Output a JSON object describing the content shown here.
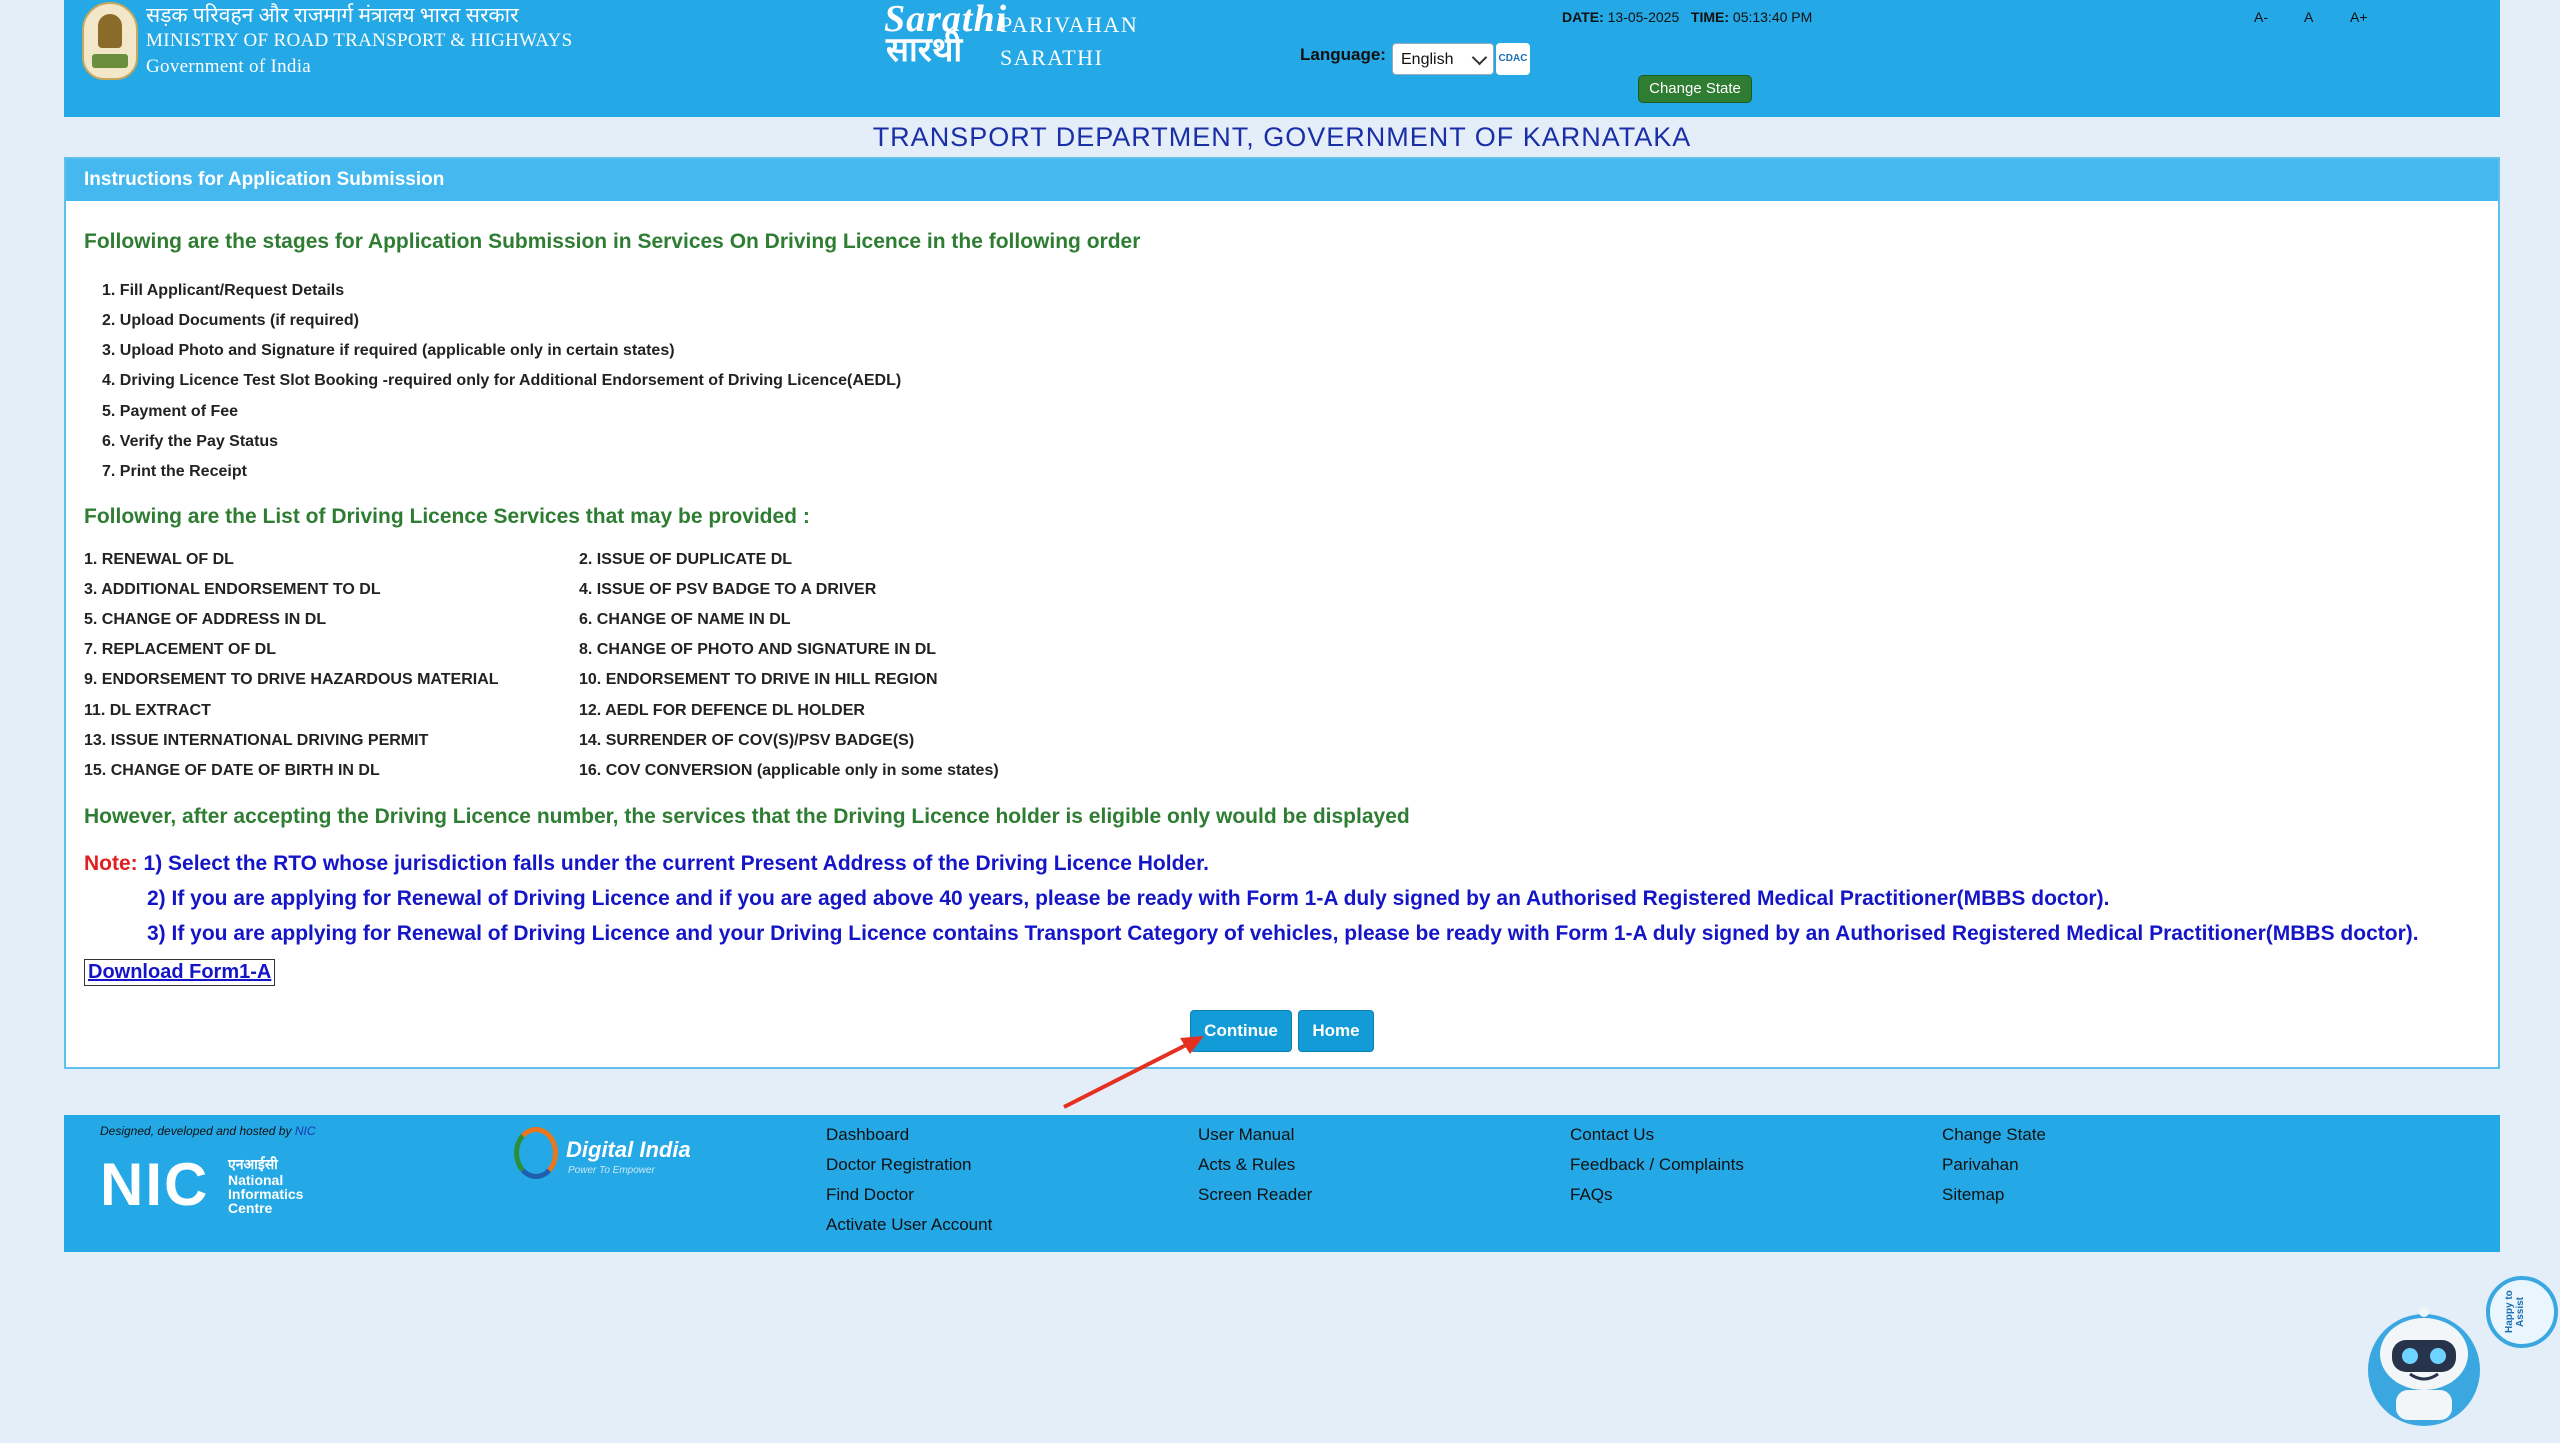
{
  "header": {
    "ministry_hindi": "सड़क परिवहन और राजमार्ग मंत्रालय भारत सरकार",
    "ministry_english": "MINISTRY OF ROAD TRANSPORT & HIGHWAYS",
    "government": "Government of India",
    "sarathi_script": "Sarathi",
    "sarathi_script_hindi": "सारथी",
    "parivahan": "PARIVAHAN",
    "sarathi": "SARATHI",
    "language_label": "Language:",
    "language_value": "English",
    "cdac_label": "सी-डैक CDAC",
    "date_label": "DATE:",
    "date_value": "13-05-2025",
    "time_label": "TIME:",
    "time_value": "05:13:40 PM",
    "change_state": "Change State",
    "font_decrease": "A-",
    "font_normal": "A",
    "font_increase": "A+"
  },
  "dept_title": "TRANSPORT DEPARTMENT, GOVERNMENT OF KARNATAKA",
  "panel": {
    "heading": "Instructions for Application Submission",
    "stages_heading": "Following are the stages for Application Submission in Services On Driving Licence in the following order",
    "stages": [
      "1. Fill Applicant/Request Details",
      "2. Upload Documents (if required)",
      "3. Upload Photo and Signature if required (applicable only in certain states)",
      "4. Driving Licence Test Slot Booking -required only for Additional Endorsement of Driving Licence(AEDL)",
      "5. Payment of Fee",
      "6. Verify the Pay Status",
      "7. Print the Receipt"
    ],
    "services_heading": "Following are the List of Driving Licence Services that may be provided :",
    "services_left": [
      "1.  RENEWAL OF DL",
      "3.  ADDITIONAL ENDORSEMENT TO DL",
      "5.  CHANGE OF ADDRESS IN DL",
      "7.  REPLACEMENT OF DL",
      "9.  ENDORSEMENT TO DRIVE HAZARDOUS MATERIAL",
      "11. DL EXTRACT",
      "13. ISSUE INTERNATIONAL DRIVING PERMIT",
      "15. CHANGE OF DATE OF BIRTH IN DL"
    ],
    "services_right": [
      "2.  ISSUE OF DUPLICATE DL",
      "4.  ISSUE OF PSV BADGE TO A DRIVER",
      "6.  CHANGE OF NAME IN DL",
      "8.  CHANGE OF PHOTO AND SIGNATURE IN DL",
      "10. ENDORSEMENT TO DRIVE IN HILL REGION",
      "12. AEDL FOR DEFENCE DL HOLDER",
      "14. SURRENDER OF COV(S)/PSV BADGE(S)",
      "16. COV CONVERSION (applicable only in some states)"
    ],
    "however_text": "However, after accepting the Driving Licence number, the services that the Driving Licence holder is eligible only would be displayed",
    "note_label": "Note:",
    "notes": [
      "1) Select the RTO whose jurisdiction falls under the current Present Address of the Driving Licence Holder.",
      "2) If you are applying for Renewal of Driving Licence and if you are aged above 40 years, please be ready with Form 1-A duly signed by an Authorised Registered Medical Practitioner(MBBS doctor).",
      "3) If you are applying for Renewal of Driving Licence and your Driving Licence contains Transport Category of vehicles, please be ready with Form 1-A duly signed by an Authorised Registered Medical Practitioner(MBBS doctor)."
    ],
    "download_link": "Download Form1-A",
    "continue_button": "Continue",
    "home_button": "Home"
  },
  "footer": {
    "designed_text": "Designed, developed and hosted by",
    "designed_by": "NIC",
    "nic_logo": "NIC",
    "nic_hindi": "एनआईसी",
    "nic_full": "National Informatics Centre",
    "digital_india": "Digital India",
    "digital_india_tag": "Power To Empower",
    "col1": [
      "Dashboard",
      "Doctor Registration",
      "Find Doctor",
      "Activate User Account"
    ],
    "col2": [
      "User Manual",
      "Acts & Rules",
      "Screen Reader"
    ],
    "col3": [
      "Contact Us",
      "Feedback / Complaints",
      "FAQs"
    ],
    "col4": [
      "Change State",
      "Parivahan",
      "Sitemap"
    ]
  },
  "chatbot": {
    "bubble_text": "Happy to Assist"
  },
  "colors": {
    "header_blue": "#24a8e6",
    "panel_head": "#45b9ef",
    "heading_green": "#2e7d32",
    "note_blue": "#1515c8",
    "note_red": "#e02020",
    "button_blue": "#139bd8",
    "page_bg": "#e4eef8"
  }
}
